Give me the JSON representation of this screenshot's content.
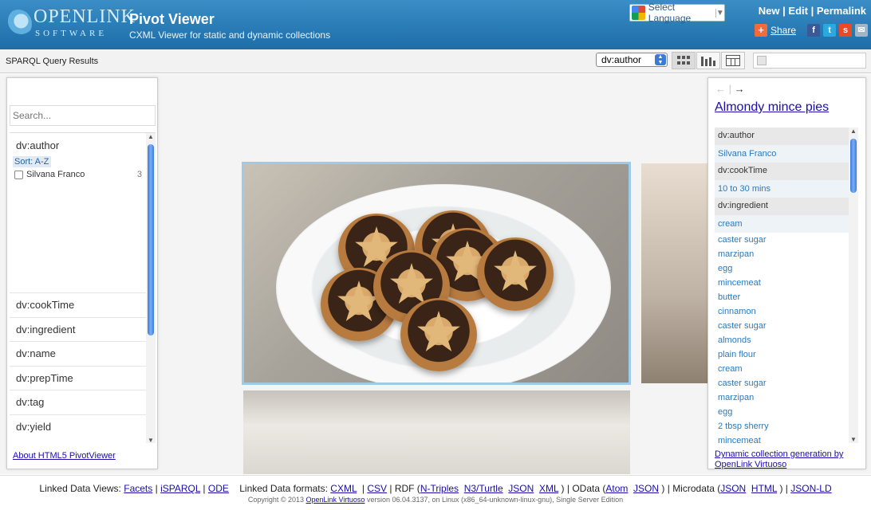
{
  "header": {
    "logo_top": "OPENLINK",
    "logo_bottom": "SOFTWARE",
    "title": "Pivot Viewer",
    "subtitle": "CXML Viewer for static and dynamic collections",
    "language": "Select Language",
    "links": [
      "New",
      "Edit",
      "Permalink"
    ],
    "share": "Share"
  },
  "toolbar": {
    "title": "SPARQL Query Results",
    "sort_value": "dv:author"
  },
  "filter": {
    "search_placeholder": "Search...",
    "open_facet": "dv:author",
    "sort_label": "Sort: A-Z",
    "value": {
      "label": "Silvana Franco",
      "count": "3"
    },
    "facets": [
      "dv:cookTime",
      "dv:ingredient",
      "dv:name",
      "dv:prepTime",
      "dv:tag",
      "dv:yield"
    ],
    "about": "About HTML5 PivotViewer"
  },
  "detail": {
    "title": "Almondy mince pies",
    "author_head": "dv:author",
    "author": "Silvana Franco",
    "cook_head": "dv:cookTime",
    "cook": "10 to 30 mins",
    "ing_head": "dv:ingredient",
    "ingredients": [
      "cream",
      "caster sugar",
      "marzipan",
      "egg",
      "mincemeat",
      "butter",
      "cinnamon",
      "caster sugar",
      "almonds",
      "plain flour",
      "cream",
      "caster sugar",
      "marzipan",
      "egg",
      "2 tbsp sherry",
      "mincemeat"
    ],
    "dyn_link": "Dynamic collection generation by OpenLink Virtuoso"
  },
  "footer": {
    "views_label": "Linked Data Views:",
    "views": [
      "Facets",
      "iSPARQL",
      "ODE"
    ],
    "formats_label": "Linked Data formats:",
    "formats": [
      "CXML",
      "CSV"
    ],
    "rdf_label": "RDF (",
    "rdf": [
      "N-Triples",
      "N3/Turtle",
      "JSON",
      "XML"
    ],
    "odata_label": "OData (",
    "odata": [
      "Atom",
      "JSON"
    ],
    "micro_label": "Microdata (",
    "micro": [
      "JSON",
      "HTML"
    ],
    "jsonld": "JSON-LD",
    "copyright_pre": "Copyright © 2013",
    "copyright_link": "OpenLink Virtuoso",
    "copyright_post": "version 06.04.3137, on Linux (x86_64-unknown-linux-gnu), Single Server Edition"
  }
}
